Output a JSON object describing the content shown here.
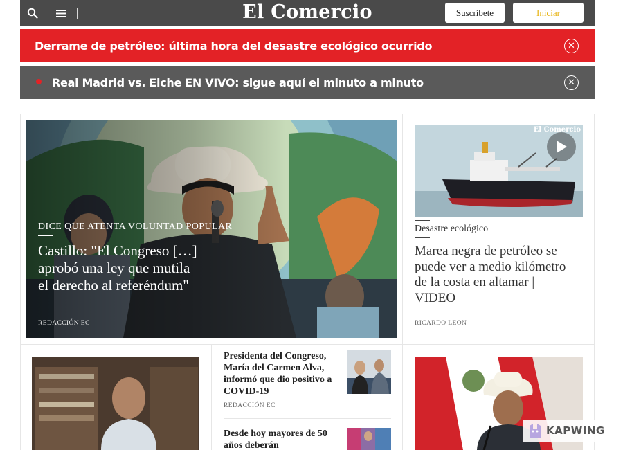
{
  "header": {
    "logo": "El Comercio",
    "subscribe_label": "Suscríbete",
    "login_label": "Iniciar",
    "icons": [
      "search-icon",
      "menu-icon"
    ]
  },
  "alerts": [
    {
      "text": "Derrame de petróleo: última hora del desastre ecológico ocurrido",
      "style": "red"
    },
    {
      "text": "Real Madrid vs. Elche EN VIVO: sigue aquí el minuto a minuto",
      "style": "live"
    }
  ],
  "main_story": {
    "kicker": "DICE QUE ATENTA VOLUNTAD POPULAR",
    "title": "Castillo: \"El Congreso […] aprobó una ley que mutila el derecho al referéndum\"",
    "author": "REDACCIÓN EC"
  },
  "side_story": {
    "watermark": "El Comercio",
    "kicker": "Desastre ecológico",
    "title": "Marea negra de petróleo se puede ver a medio kilómetro de la costa en altamar | VIDEO",
    "author": "RICARDO LEON"
  },
  "bottom_list": [
    {
      "title": "Presidenta del Congreso, María del Carmen Alva, informó que dio positivo a COVID-19",
      "author": "REDACCIÓN EC"
    },
    {
      "title": "Desde hoy mayores de 50 años deberán"
    }
  ],
  "overlay": {
    "brand": "KAPWING"
  },
  "colors": {
    "header_bg": "#4a4a4a",
    "alert_red": "#e32226",
    "alert_gray": "#5a5a5a",
    "login_text": "#e7b310"
  }
}
